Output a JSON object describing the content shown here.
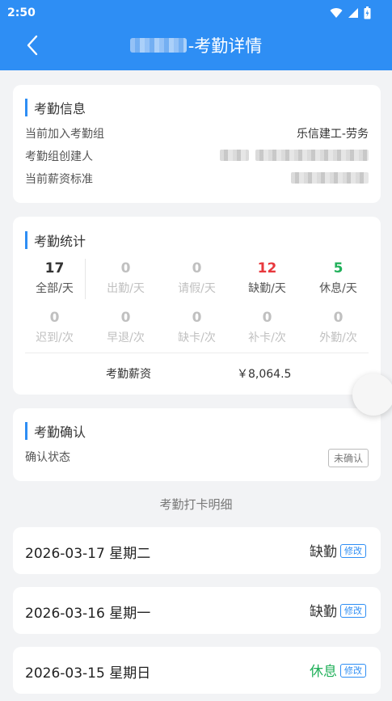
{
  "status_bar": {
    "time": "2:50"
  },
  "header": {
    "title": "-考勤详情",
    "back_icon": "chevron-left-icon"
  },
  "info": {
    "title": "考勤信息",
    "rows": [
      {
        "label": "当前加入考勤组",
        "value": "乐信建工-劳务"
      },
      {
        "label": "考勤组创建人",
        "value": ""
      },
      {
        "label": "当前薪资标准",
        "value": ""
      }
    ]
  },
  "stats": {
    "title": "考勤统计",
    "row1": [
      {
        "value": "17",
        "label": "全部/天",
        "color": "#333333"
      },
      {
        "value": "0",
        "label": "出勤/天",
        "color": "#c0c0c0"
      },
      {
        "value": "0",
        "label": "请假/天",
        "color": "#c0c0c0"
      },
      {
        "value": "12",
        "label": "缺勤/天",
        "color": "#e8383d"
      },
      {
        "value": "5",
        "label": "休息/天",
        "color": "#21b05a"
      }
    ],
    "row2": [
      {
        "value": "0",
        "label": "迟到/次"
      },
      {
        "value": "0",
        "label": "早退/次"
      },
      {
        "value": "0",
        "label": "缺卡/次"
      },
      {
        "value": "0",
        "label": "补卡/次"
      },
      {
        "value": "0",
        "label": "外勤/次"
      }
    ],
    "salary_label": "考勤薪资",
    "salary_value": "￥8,064.5"
  },
  "confirm": {
    "title": "考勤确认",
    "status_label": "确认状态",
    "status_value": "未确认"
  },
  "detail": {
    "title": "考勤打卡明细",
    "days": [
      {
        "date": "2026-03-17 星期二",
        "status": "缺勤",
        "status_color": "#333333",
        "edit": "修改"
      },
      {
        "date": "2026-03-16 星期一",
        "status": "缺勤",
        "status_color": "#333333",
        "edit": "修改"
      },
      {
        "date": "2026-03-15 星期日",
        "status": "休息",
        "status_color": "#21b05a",
        "edit": "修改"
      }
    ]
  }
}
